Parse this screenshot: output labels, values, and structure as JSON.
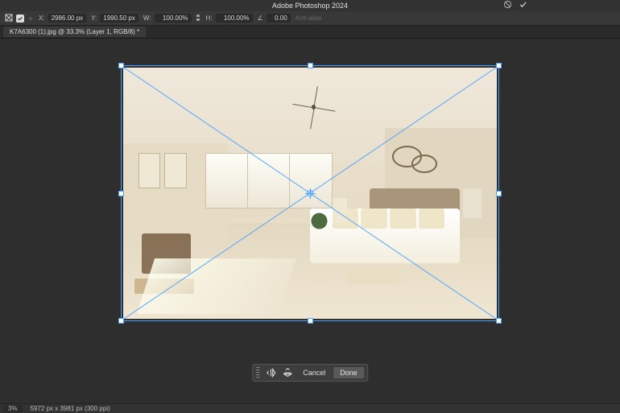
{
  "titlebar": {
    "app_name": "Adobe Photoshop 2024"
  },
  "options": {
    "x_label": "X:",
    "x_value": "2986.00 px",
    "y_label": "Y:",
    "y_value": "1990.50 px",
    "w_label": "W:",
    "w_value": "100.00%",
    "h_label": "H:",
    "h_value": "100.00%",
    "angle_label": "∠",
    "angle_value": "0.00",
    "antialias_label": "Anti-alias"
  },
  "document": {
    "tab_title": "K7A6300 (1).jpg @ 33.3% (Layer 1, RGB/8) *"
  },
  "confirm": {
    "cancel": "Cancel",
    "done": "Done"
  },
  "status": {
    "zoom": "3%",
    "dims": "5972 px x 3981 px (300 ppi)"
  }
}
